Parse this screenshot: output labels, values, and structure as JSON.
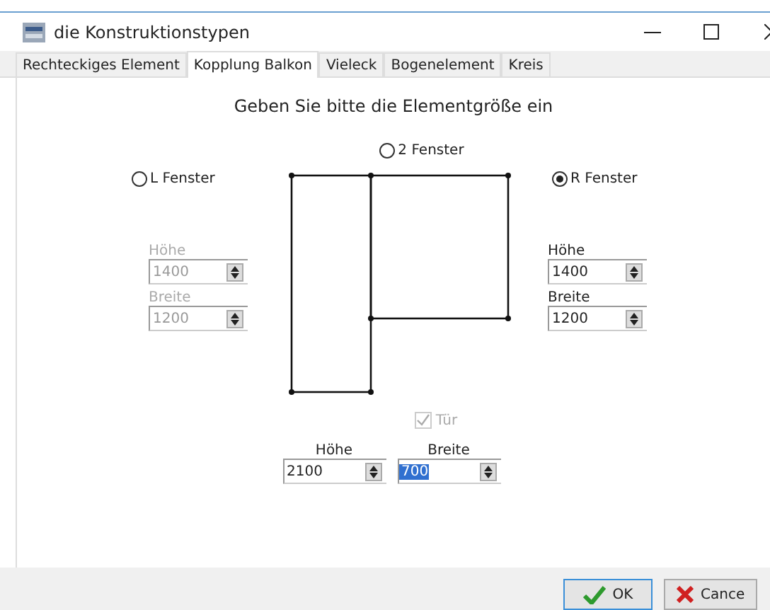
{
  "window": {
    "title": "die Konstruktionstypen"
  },
  "tabs": [
    {
      "label": "Rechteckiges Element",
      "selected": false
    },
    {
      "label": "Kopplung Balkon",
      "selected": true
    },
    {
      "label": "Vieleck",
      "selected": false
    },
    {
      "label": "Bogenelement",
      "selected": false
    },
    {
      "label": "Kreis",
      "selected": false
    }
  ],
  "heading": "Geben Sie bitte die Elementgröße ein",
  "radios": [
    {
      "label": "L Fenster",
      "selected": false
    },
    {
      "label": "2 Fenster",
      "selected": false
    },
    {
      "label": "R Fenster",
      "selected": true
    }
  ],
  "left_fields": [
    {
      "label": "Höhe",
      "value": "1400",
      "disabled": true
    },
    {
      "label": "Breite",
      "value": "1200",
      "disabled": true
    }
  ],
  "right_fields": [
    {
      "label": "Höhe",
      "value": "1400",
      "disabled": false
    },
    {
      "label": "Breite",
      "value": "1200",
      "disabled": false
    }
  ],
  "door_checkbox": {
    "label": "Tür",
    "checked": true,
    "disabled": true
  },
  "door_fields": [
    {
      "label": "Höhe",
      "value": "2100",
      "disabled": false,
      "highlighted": false
    },
    {
      "label": "Breite",
      "value": "700",
      "disabled": false,
      "highlighted": true
    }
  ],
  "buttons": [
    {
      "kind": "ok",
      "label": "OK"
    },
    {
      "kind": "cancel",
      "label": "Cance"
    }
  ]
}
